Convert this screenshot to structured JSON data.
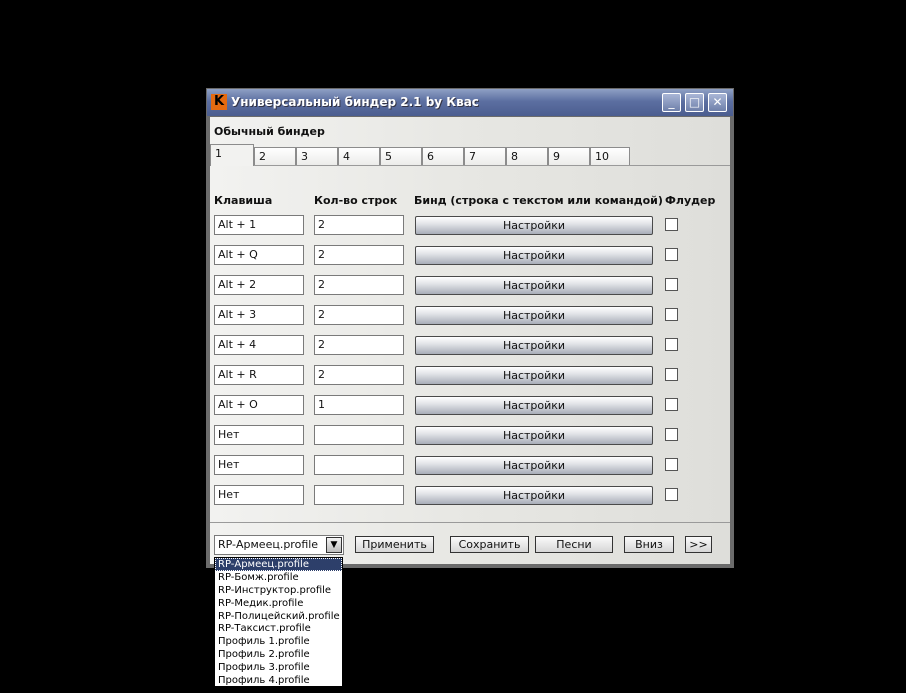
{
  "window": {
    "title": "Универсальный биндер 2.1 by Квас",
    "icon_letter": "K",
    "minimize": "_",
    "maximize": "□",
    "close": "✕"
  },
  "group_label": "Обычный биндер",
  "tabs": [
    "1",
    "2",
    "3",
    "4",
    "5",
    "6",
    "7",
    "8",
    "9",
    "10"
  ],
  "active_tab": "1",
  "columns": {
    "key": "Клавиша",
    "lines": "Кол-во строк",
    "bind": "Бинд (строка с текстом или командой)",
    "flood": "Флудер"
  },
  "rows": [
    {
      "key": "Alt + 1",
      "lines": "2",
      "button": "Настройки",
      "flood": false
    },
    {
      "key": "Alt + Q",
      "lines": "2",
      "button": "Настройки",
      "flood": false
    },
    {
      "key": "Alt + 2",
      "lines": "2",
      "button": "Настройки",
      "flood": false
    },
    {
      "key": "Alt + 3",
      "lines": "2",
      "button": "Настройки",
      "flood": false
    },
    {
      "key": "Alt + 4",
      "lines": "2",
      "button": "Настройки",
      "flood": false
    },
    {
      "key": "Alt + R",
      "lines": "2",
      "button": "Настройки",
      "flood": false
    },
    {
      "key": "Alt + O",
      "lines": "1",
      "button": "Настройки",
      "flood": false
    },
    {
      "key": "Нет",
      "lines": "",
      "button": "Настройки",
      "flood": false
    },
    {
      "key": "Нет",
      "lines": "",
      "button": "Настройки",
      "flood": false
    },
    {
      "key": "Нет",
      "lines": "",
      "button": "Настройки",
      "flood": false
    }
  ],
  "profile_select": {
    "value": "RP-Армеец.profile",
    "options": [
      "RP-Армеец.profile",
      "RP-Бомж.profile",
      "RP-Инструктор.profile",
      "RP-Медик.profile",
      "RP-Полицейский.profile",
      "RP-Таксист.profile",
      "Профиль 1.profile",
      "Профиль 2.profile",
      "Профиль 3.profile",
      "Профиль 4.profile"
    ]
  },
  "actions": {
    "apply": "Применить",
    "save": "Сохранить",
    "songs": "Песни",
    "down": "Вниз",
    "more": ">>"
  },
  "colors": {
    "titlebar": "#5c6fa1",
    "app_icon": "#e46a11",
    "selected_option": "#2d3f6a"
  }
}
